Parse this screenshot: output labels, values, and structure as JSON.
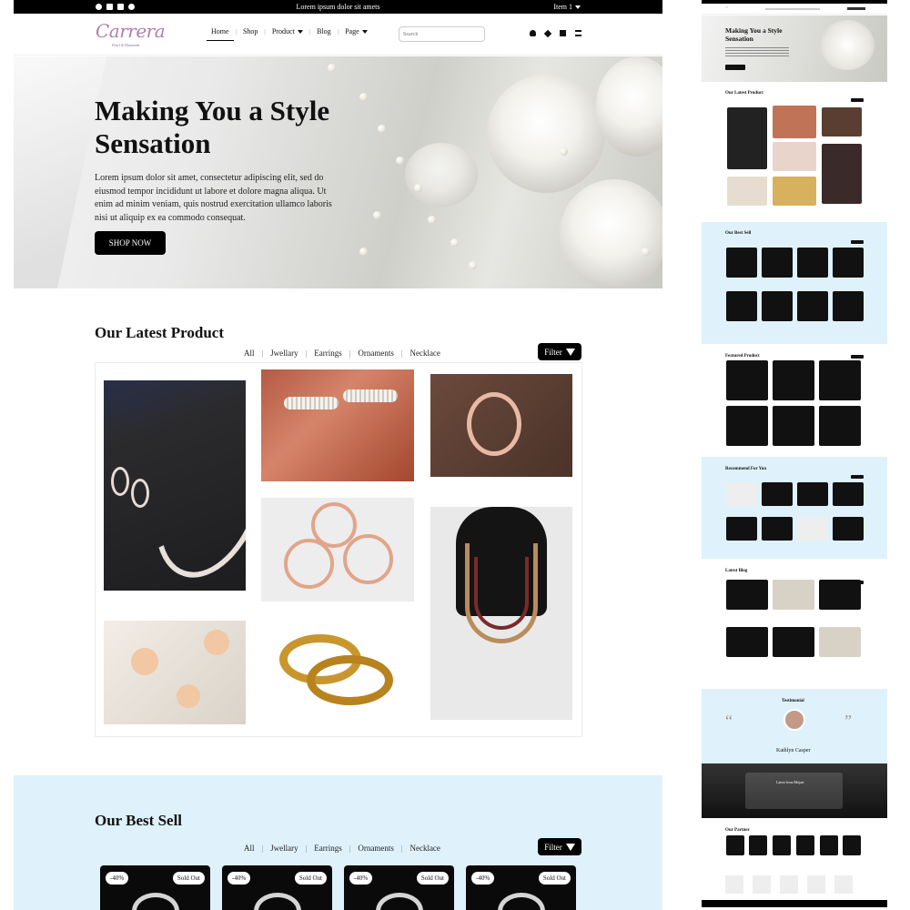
{
  "topbar": {
    "announcement": "Lorem ipsum dolor sit amets",
    "item_selector": "Item 1",
    "social_icons": [
      "facebook-icon",
      "instagram-icon",
      "linkedin-icon",
      "twitter-icon"
    ]
  },
  "nav": {
    "items": [
      {
        "label": "Home",
        "active": true
      },
      {
        "label": "Shop"
      },
      {
        "label": "Product",
        "dropdown": true
      },
      {
        "label": "Blog"
      },
      {
        "label": "Page",
        "dropdown": true
      }
    ],
    "search_placeholder": "Search",
    "action_icons": [
      "user-icon",
      "heart-icon",
      "cart-icon",
      "menu-list-icon"
    ]
  },
  "logo": {
    "text": "Carrera",
    "tagline": "Pearl & Diamonds"
  },
  "hero": {
    "title_line1": "Making You a Style",
    "title_line2": "Sensation",
    "body": "Lorem ipsum dolor sit amet, consectetur adipiscing elit, sed do eiusmod tempor incididunt ut labore et dolore magna aliqua. Ut enim ad minim veniam, quis nostrud exercitation ullamco laboris nisi ut aliquip ex ea commodo consequat.",
    "button": "SHOP NOW"
  },
  "latest": {
    "title": "Our Latest Product",
    "filters": [
      "All",
      "Jwellary",
      "Earrings",
      "Ornaments",
      "Necklace"
    ],
    "filter_button": "Filter"
  },
  "best_sell": {
    "title": "Our Best Sell",
    "filters": [
      "All",
      "Jwellary",
      "Earrings",
      "Ornaments",
      "Necklace"
    ],
    "filter_button": "Filter",
    "cards": [
      {
        "discount": "-40%",
        "status": "Sold Out"
      },
      {
        "discount": "-40%",
        "status": "Sold Out"
      },
      {
        "discount": "-40%",
        "status": "Sold Out"
      },
      {
        "discount": "-40%",
        "status": "Sold Out"
      }
    ]
  },
  "thumbnail": {
    "hero_title_line1": "Making You a Style",
    "hero_title_line2": "Sensation",
    "sections": [
      "Our Latest Product",
      "Our Best Sell",
      "Featured Product",
      "Recommend For You",
      "Latest Blog",
      "Testimonial",
      "Latest from Mojari",
      "Our Partner"
    ],
    "testimonial_name": "Kathlyn Casper"
  },
  "colors": {
    "accent_light_blue": "#dff2fb",
    "brand_purple": "#b27cae",
    "dark": "#000000"
  }
}
